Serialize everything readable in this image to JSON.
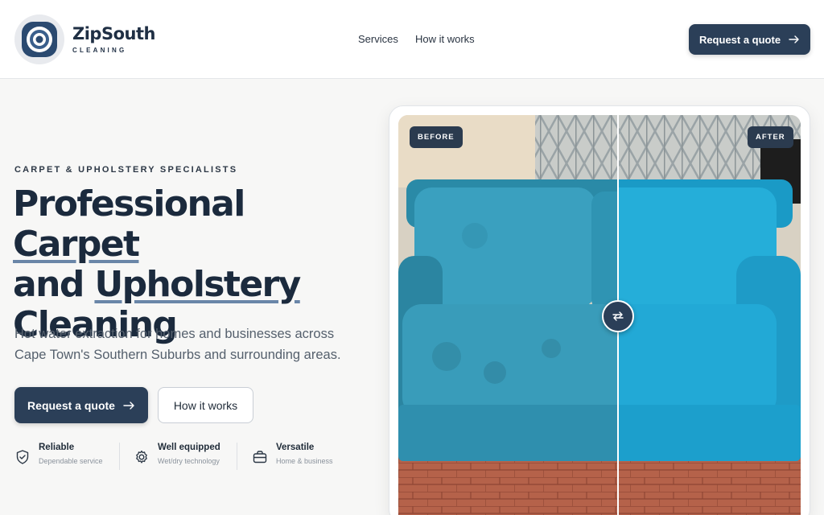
{
  "brand": {
    "name": "ZipSouth",
    "tagline": "CLEANING"
  },
  "nav": {
    "items": [
      {
        "label": "Services"
      },
      {
        "label": "How it works"
      }
    ]
  },
  "header_cta": {
    "label": "Request a quote"
  },
  "hero": {
    "eyebrow": "CARPET & UPHOLSTERY SPECIALISTS",
    "headline": {
      "part1": "Professional ",
      "highlight1": "Carpet",
      "part2": "and ",
      "highlight2": "Upholstery",
      "part3": "Cleaning"
    },
    "subtitle": "Hot water extraction for homes and businesses across Cape Town's Southern Suburbs and surrounding areas.",
    "primary_cta": "Request a quote",
    "secondary_cta": "How it works"
  },
  "features": [
    {
      "title": "Reliable",
      "subtitle": "Dependable service",
      "icon": "shield-check-icon"
    },
    {
      "title": "Well equipped",
      "subtitle": "Wet/dry technology",
      "icon": "gear-icon"
    },
    {
      "title": "Versatile",
      "subtitle": "Home & business",
      "icon": "briefcase-icon"
    }
  ],
  "comparison": {
    "before_label": "BEFORE",
    "after_label": "AFTER",
    "handle_icon": "swap-arrows-icon",
    "split_position": 0.55
  },
  "colors": {
    "primary": "#2b3f58",
    "text_dark": "#1b2a3d",
    "underline_accent": "#6a86a8",
    "page_bg": "#f7f7f6"
  }
}
